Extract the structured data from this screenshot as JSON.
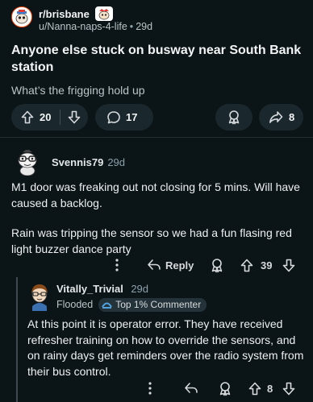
{
  "post": {
    "subreddit": "r/brisbane",
    "author": "u/Nanna-naps-4-life",
    "dot": "•",
    "age": "29d",
    "title": "Anyone else stuck on busway near South Bank station",
    "body": "What’s the frigging hold up",
    "upvotes": "20",
    "comments": "17",
    "shares": "8"
  },
  "comment1": {
    "username": "Svennis79",
    "age": "29d",
    "paragraphs": [
      "M1 door was freaking out not closing for 5 mins. Will have caused a backlog.",
      "Rain was tripping the sensor so we had a fun flasing red light buzzer dance party"
    ],
    "reply_label": "Reply",
    "votes": "39"
  },
  "comment2": {
    "username": "Vitally_Trivial",
    "age": "29d",
    "flair": "Flooded",
    "badge": "Top 1% Commenter",
    "body": "At this point it is operator error. They have received refresher training on how to override the sensors, and on rainy days get reminders over the radio system from their bus control.",
    "votes": "8"
  },
  "colors": {
    "background": "#0b1416",
    "pill": "#1a282d",
    "accent": "#ff4500"
  },
  "icons": [
    "upvote-icon",
    "downvote-icon",
    "comment-icon",
    "award-icon",
    "share-icon",
    "more-icon",
    "reply-icon",
    "top-commenter-icon"
  ]
}
